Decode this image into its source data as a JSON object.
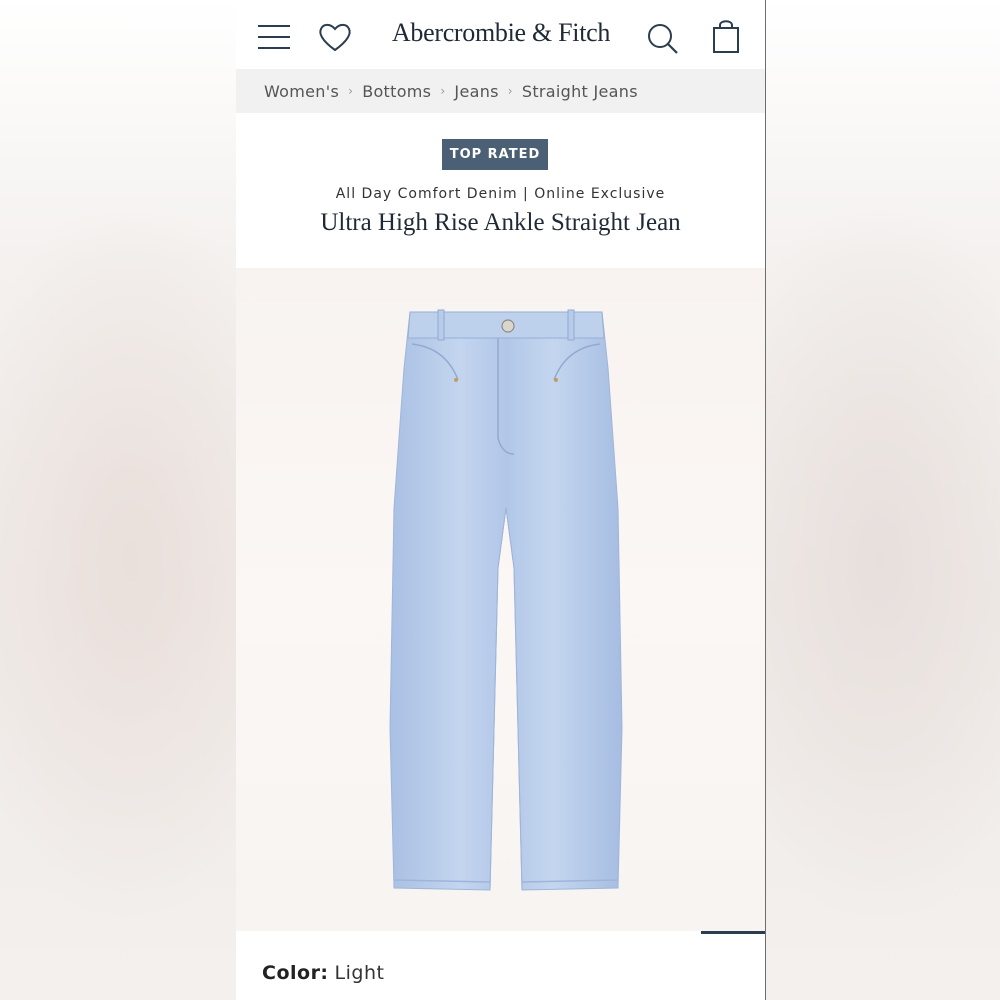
{
  "header": {
    "brand": "Abercrombie & Fitch",
    "icons": [
      "menu-icon",
      "heart-icon",
      "search-icon",
      "shopping-bag-icon"
    ]
  },
  "breadcrumb": {
    "items": [
      "Women's",
      "Bottoms",
      "Jeans",
      "Straight Jeans"
    ]
  },
  "product": {
    "badge": "TOP RATED",
    "subtitle": "All Day Comfort Denim | Online Exclusive",
    "title": "Ultra High Rise Ankle Straight Jean",
    "image": "light-wash-straight-jeans",
    "gallery_progress": 0.12,
    "color_label": "Color:",
    "color_value": "Light"
  },
  "colors": {
    "badge_bg": "#4b6074",
    "text_dark": "#1f2a36",
    "progress": "#2b3d4f",
    "denim": "#b5cbea"
  }
}
